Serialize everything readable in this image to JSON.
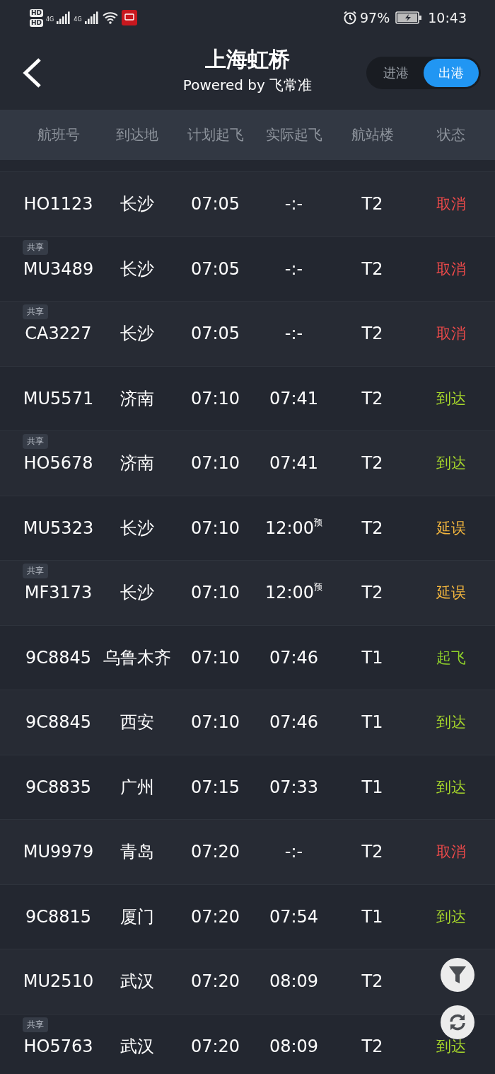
{
  "status_bar": {
    "hd_badges": [
      "HD",
      "HD"
    ],
    "network_labels": [
      "4G",
      "4G"
    ],
    "battery": "97%",
    "time": "10:43"
  },
  "header": {
    "title": "上海虹桥",
    "subtitle": "Powered by 飞常准",
    "tabs": [
      {
        "label": "进港",
        "selected": false
      },
      {
        "label": "出港",
        "selected": true
      }
    ]
  },
  "table": {
    "columns": [
      "航班号",
      "到达地",
      "计划起飞",
      "实际起飞",
      "航站楼",
      "状态"
    ],
    "rows": [
      {
        "flight": "HO1123",
        "destination": "长沙",
        "planned": "07:05",
        "actual": "-:-",
        "terminal": "T2",
        "status": "取消",
        "color": "#ec4a4a"
      },
      {
        "badge": "共享",
        "flight": "MU3489",
        "destination": "长沙",
        "planned": "07:05",
        "actual": "-:-",
        "terminal": "T2",
        "status": "取消",
        "color": "#ec4a4a"
      },
      {
        "badge": "共享",
        "flight": "CA3227",
        "destination": "长沙",
        "planned": "07:05",
        "actual": "-:-",
        "terminal": "T2",
        "status": "取消",
        "color": "#ec4a4a"
      },
      {
        "flight": "MU5571",
        "destination": "济南",
        "planned": "07:10",
        "actual": "07:41",
        "terminal": "T2",
        "status": "到达",
        "color": "#a6d62b"
      },
      {
        "badge": "共享",
        "flight": "HO5678",
        "destination": "济南",
        "planned": "07:10",
        "actual": "07:41",
        "terminal": "T2",
        "status": "到达",
        "color": "#a6d62b"
      },
      {
        "flight": "MU5323",
        "destination": "长沙",
        "planned": "07:10",
        "actual": "12:00",
        "actual_mark": "预",
        "terminal": "T2",
        "status": "延误",
        "color": "#f4b73e"
      },
      {
        "badge": "共享",
        "flight": "MF3173",
        "destination": "长沙",
        "planned": "07:10",
        "actual": "12:00",
        "actual_mark": "预",
        "terminal": "T2",
        "status": "延误",
        "color": "#f4b73e"
      },
      {
        "flight": "9C8845",
        "destination": "乌鲁木齐",
        "planned": "07:10",
        "actual": "07:46",
        "terminal": "T1",
        "status": "起飞",
        "color": "#8fd12a"
      },
      {
        "flight": "9C8845",
        "destination": "西安",
        "planned": "07:10",
        "actual": "07:46",
        "terminal": "T1",
        "status": "到达",
        "color": "#a6d62b"
      },
      {
        "flight": "9C8835",
        "destination": "广州",
        "planned": "07:15",
        "actual": "07:33",
        "terminal": "T1",
        "status": "到达",
        "color": "#a6d62b"
      },
      {
        "flight": "MU9979",
        "destination": "青岛",
        "planned": "07:20",
        "actual": "-:-",
        "terminal": "T2",
        "status": "取消",
        "color": "#ec4a4a"
      },
      {
        "flight": "9C8815",
        "destination": "厦门",
        "planned": "07:20",
        "actual": "07:54",
        "terminal": "T1",
        "status": "到达",
        "color": "#a6d62b"
      },
      {
        "flight": "MU2510",
        "destination": "武汉",
        "planned": "07:20",
        "actual": "08:09",
        "terminal": "T2"
      },
      {
        "badge": "共享",
        "flight": "HO5763",
        "destination": "武汉",
        "planned": "07:20",
        "actual": "08:09",
        "terminal": "T2",
        "status": "到达",
        "color": "#a6d62b"
      }
    ]
  }
}
